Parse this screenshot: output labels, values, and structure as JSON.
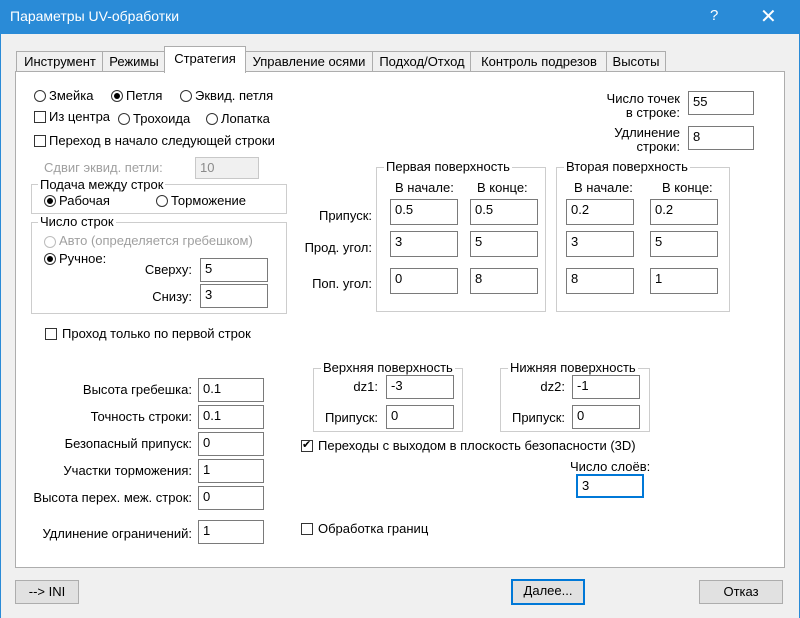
{
  "window": {
    "title": "Параметры UV-обработки",
    "help": "?",
    "close": "✕"
  },
  "tabs": [
    "Инструмент",
    "Режимы",
    "Стратегия",
    "Управление осями",
    "Подход/Отход",
    "Контроль подрезов",
    "Высоты"
  ],
  "strategy": {
    "mode_options": [
      "Змейка",
      "Петля",
      "Эквид. петля"
    ],
    "mode_selected": "Петля",
    "from_center": {
      "label": "Из центра",
      "checked": false
    },
    "motion_options": [
      "Трохоида",
      "Лопатка"
    ],
    "goto_next_row": {
      "label": "Переход в начало следующей строки",
      "checked": false
    },
    "offset_loop": {
      "label": "Сдвиг эквид. петли:",
      "value": "10"
    },
    "points_in_row": {
      "label_line1": "Число точек",
      "label_line2": "в строке:",
      "value": "55"
    },
    "row_extension": {
      "label_line1": "Удлинение",
      "label_line2": "строки:",
      "value": "8"
    }
  },
  "feed_between_rows": {
    "title": "Подача между строк",
    "options": [
      "Рабочая",
      "Торможение"
    ],
    "selected": "Рабочая"
  },
  "rows_count": {
    "title": "Число строк",
    "auto": "Авто (определяется гребешком)",
    "manual": "Ручное:",
    "top_label": "Сверху:",
    "top_value": "5",
    "bottom_label": "Снизу:",
    "bottom_value": "3"
  },
  "surfaces": {
    "first_title": "Первая поверхность",
    "second_title": "Вторая поверхность",
    "col_start": "В начале:",
    "col_end": "В конце:",
    "rows": [
      {
        "label": "Припуск:",
        "first": [
          "0.5",
          "0.5"
        ],
        "second": [
          "0.2",
          "0.2"
        ]
      },
      {
        "label": "Прод. угол:",
        "first": [
          "3",
          "5"
        ],
        "second": [
          "3",
          "5"
        ]
      },
      {
        "label": "Поп. угол:",
        "first": [
          "0",
          "8"
        ],
        "second": [
          "8",
          "1"
        ]
      }
    ]
  },
  "first_row_only": {
    "label": "Проход только по первой строк",
    "checked": false
  },
  "params": [
    {
      "label": "Высота гребешка:",
      "value": "0.1"
    },
    {
      "label": "Точность строки:",
      "value": "0.1"
    },
    {
      "label": "Безопасный припуск:",
      "value": "0"
    },
    {
      "label": "Участки торможения:",
      "value": "1"
    },
    {
      "label": "Высота перех. меж. строк:",
      "value": "0"
    }
  ],
  "limit_extension": {
    "label": "Удлинение ограничений:",
    "value": "1"
  },
  "upper_surface": {
    "title": "Верхняя поверхность",
    "dz_label": "dz1:",
    "dz_value": "-3",
    "allow_label": "Припуск:",
    "allow_value": "0"
  },
  "lower_surface": {
    "title": "Нижняя поверхность",
    "dz_label": "dz2:",
    "dz_value": "-1",
    "allow_label": "Припуск:",
    "allow_value": "0"
  },
  "safe_plane_transitions": {
    "label": "Переходы с выходом в плоскость безопасности (3D)",
    "checked": true
  },
  "layers": {
    "label": "Число слоёв:",
    "value": "3"
  },
  "edge_processing": {
    "label": "Обработка границ",
    "checked": false
  },
  "footer": {
    "ini": "--> INI",
    "next": "Далее...",
    "cancel": "Отказ"
  }
}
